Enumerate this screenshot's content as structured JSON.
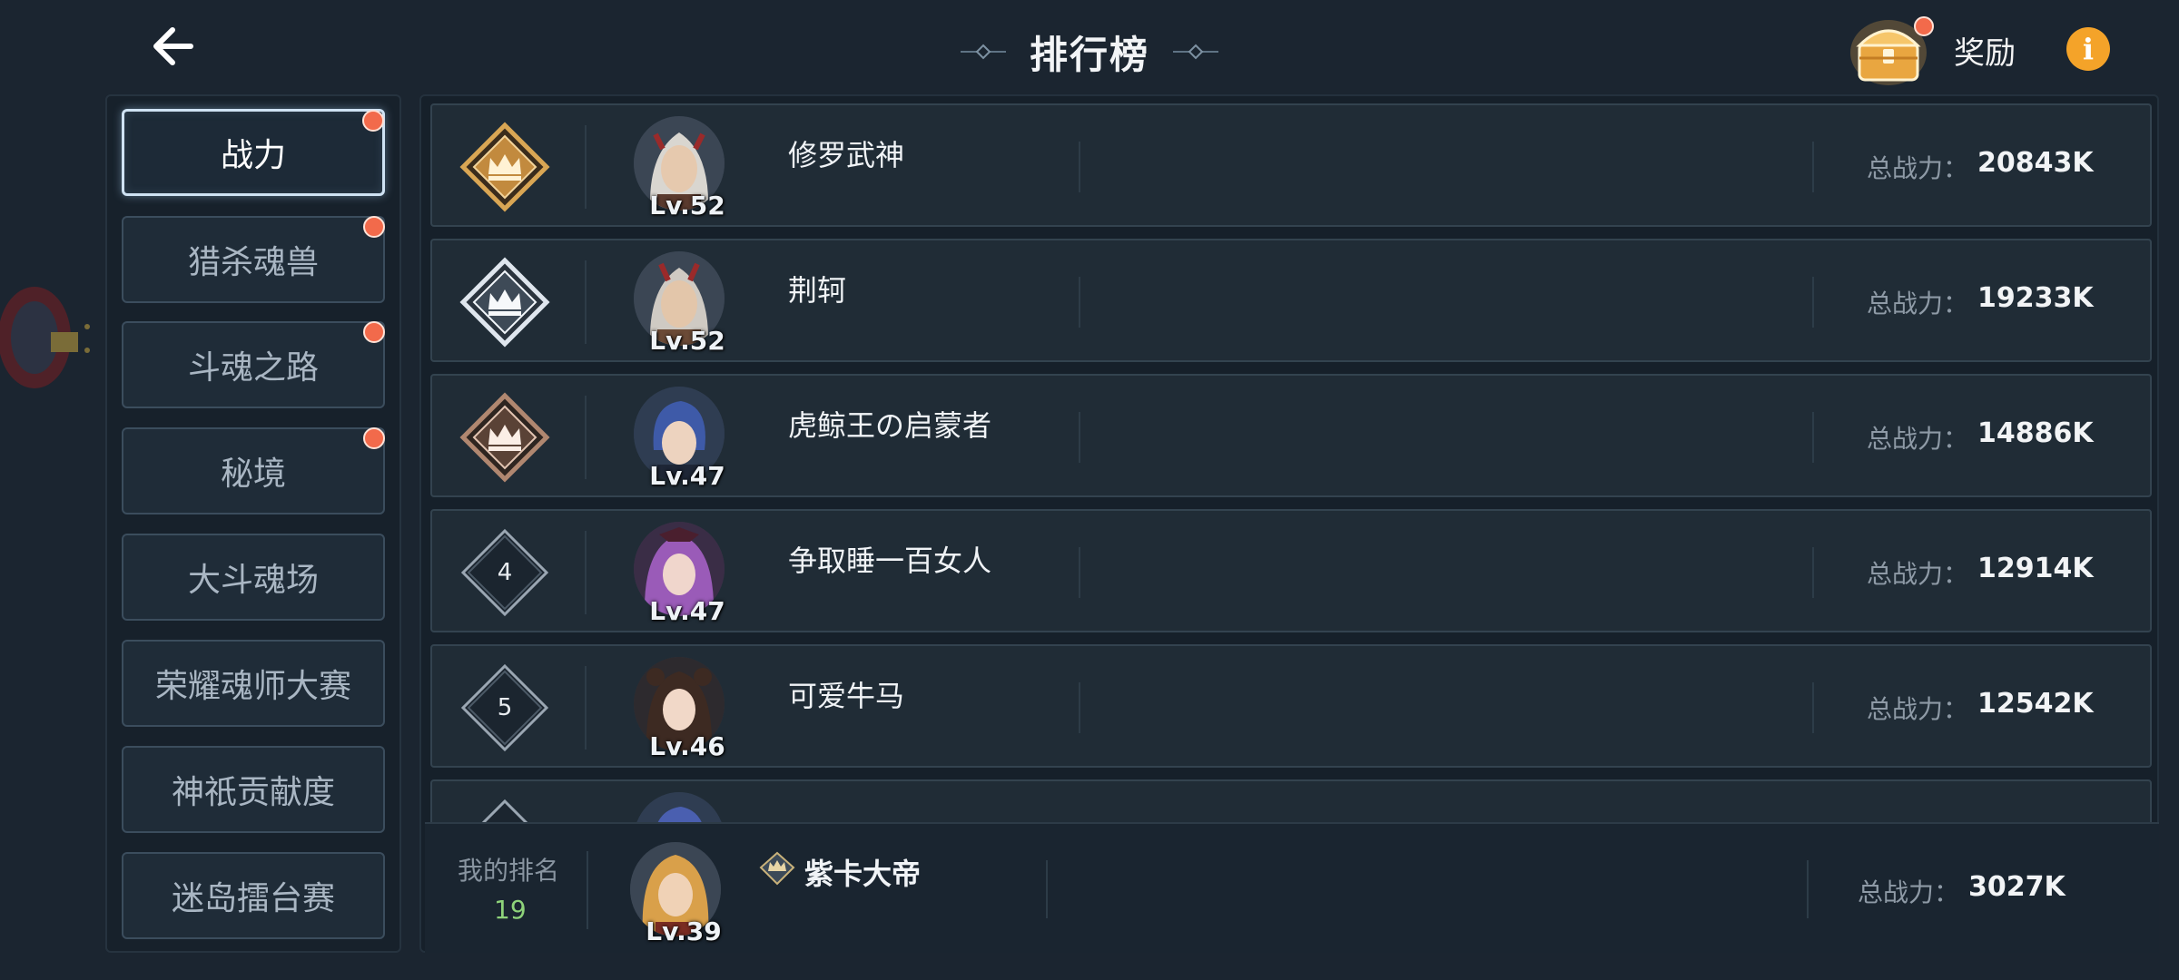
{
  "header": {
    "title": "排行榜",
    "reward_label": "奖励",
    "info_glyph": "i"
  },
  "sidebar": {
    "tabs": [
      {
        "label": "战力",
        "active": true,
        "badge": true
      },
      {
        "label": "猎杀魂兽",
        "active": false,
        "badge": true
      },
      {
        "label": "斗魂之路",
        "active": false,
        "badge": true
      },
      {
        "label": "秘境",
        "active": false,
        "badge": true
      },
      {
        "label": "大斗魂场",
        "active": false,
        "badge": false
      },
      {
        "label": "荣耀魂师大赛",
        "active": false,
        "badge": false
      },
      {
        "label": "神祇贡献度",
        "active": false,
        "badge": false
      },
      {
        "label": "迷岛擂台赛",
        "active": false,
        "badge": false
      }
    ]
  },
  "rankings": [
    {
      "rank": "1",
      "badge": "gold-crown",
      "name": "修罗武神",
      "level": "Lv.52",
      "power_label": "总战力：",
      "power": "20843K"
    },
    {
      "rank": "2",
      "badge": "silver-crown",
      "name": "荆轲",
      "level": "Lv.52",
      "power_label": "总战力：",
      "power": "19233K"
    },
    {
      "rank": "3",
      "badge": "bronze-crown",
      "name": "虎鲸王の启蒙者",
      "level": "Lv.47",
      "power_label": "总战力：",
      "power": "14886K"
    },
    {
      "rank": "4",
      "badge": "diamond",
      "name": "争取睡一百女人",
      "level": "Lv.47",
      "power_label": "总战力：",
      "power": "12914K"
    },
    {
      "rank": "5",
      "badge": "diamond",
      "name": "可爱牛马",
      "level": "Lv.46",
      "power_label": "总战力：",
      "power": "12542K"
    }
  ],
  "my_rank": {
    "label": "我的排名",
    "rank": "19",
    "name": "紫卡大帝",
    "level": "Lv.39",
    "power_label": "总战力：",
    "power": "3027K"
  },
  "colors": {
    "background": "#1b2530",
    "accent_red": "#f26a4b",
    "info_orange": "#f4a329",
    "my_rank_green": "#8ed37a",
    "gold": "#d9a654",
    "silver": "#dfe6ee",
    "bronze": "#b08770"
  },
  "icons": {
    "back": "arrow-left-icon",
    "reward": "treasure-chest-icon",
    "info": "info-icon"
  }
}
